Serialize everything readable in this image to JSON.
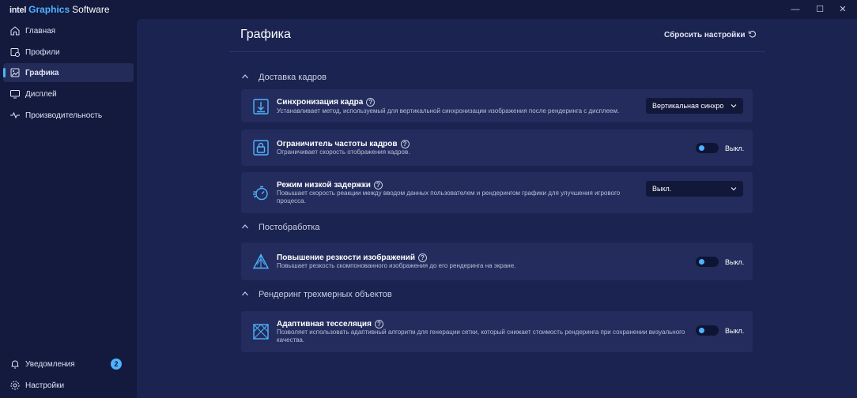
{
  "app": {
    "brand_intel": "intel",
    "brand_graphics": "Graphics",
    "brand_software": "Software"
  },
  "window_controls": {
    "minimize": "—",
    "maximize": "☐",
    "close": "✕"
  },
  "sidebar": {
    "items": [
      {
        "label": "Главная",
        "icon": "home-icon"
      },
      {
        "label": "Профили",
        "icon": "profiles-icon"
      },
      {
        "label": "Графика",
        "icon": "graphics-icon",
        "active": true
      },
      {
        "label": "Дисплей",
        "icon": "display-icon"
      },
      {
        "label": "Производительность",
        "icon": "performance-icon"
      }
    ],
    "notifications": {
      "label": "Уведомления",
      "icon": "bell-icon",
      "badge": "2"
    },
    "settings": {
      "label": "Настройки",
      "icon": "gear-icon"
    }
  },
  "main": {
    "title": "Графика",
    "reset_label": "Сбросить настройки",
    "sections": [
      {
        "label": "Доставка кадров"
      },
      {
        "label": "Постобработка"
      },
      {
        "label": "Рендеринг трехмерных объектов"
      }
    ],
    "cards": [
      {
        "title": "Синхронизация кадра",
        "help": "?",
        "description": "Устанавливает метод, используемый для вертикальной синхронизации изображения после рендеринга с дисплеем.",
        "control": "select",
        "value": "Вертикальная синхро",
        "icon": "frame-sync-icon"
      },
      {
        "title": "Ограничитель частоты кадров",
        "help": "?",
        "description": "Ограничивает скорость отображения кадров.",
        "control": "toggle",
        "value": "Выкл.",
        "icon": "frame-limiter-icon"
      },
      {
        "title": "Режим низкой задержки",
        "help": "?",
        "description_line1": "Повышает скорость реакции между вводом данных пользователем и рендерингом графики для улучшения игрового",
        "description_line2": "процесса.",
        "control": "select",
        "value": "Выкл.",
        "icon": "low-latency-icon"
      },
      {
        "title": "Повышение резкости изображений",
        "help": "?",
        "description": "Повышает резкость скомпонованного изображения до его рендеринга на экране.",
        "control": "toggle",
        "value": "Выкл.",
        "icon": "sharpen-icon"
      },
      {
        "title": "Адаптивная тесселяция",
        "help": "?",
        "description_line1": "Позволяет использовать адаптивный алгоритм для генерации сетки, который снижает стоимость рендеринга при сохранении визуального",
        "description_line2": "качества.",
        "control": "toggle",
        "value": "Выкл.",
        "icon": "tessellation-icon"
      }
    ]
  },
  "colors": {
    "accent": "#4fb3ff",
    "background": "#131a3e",
    "panel": "#1b2350",
    "card": "#232c5c"
  }
}
